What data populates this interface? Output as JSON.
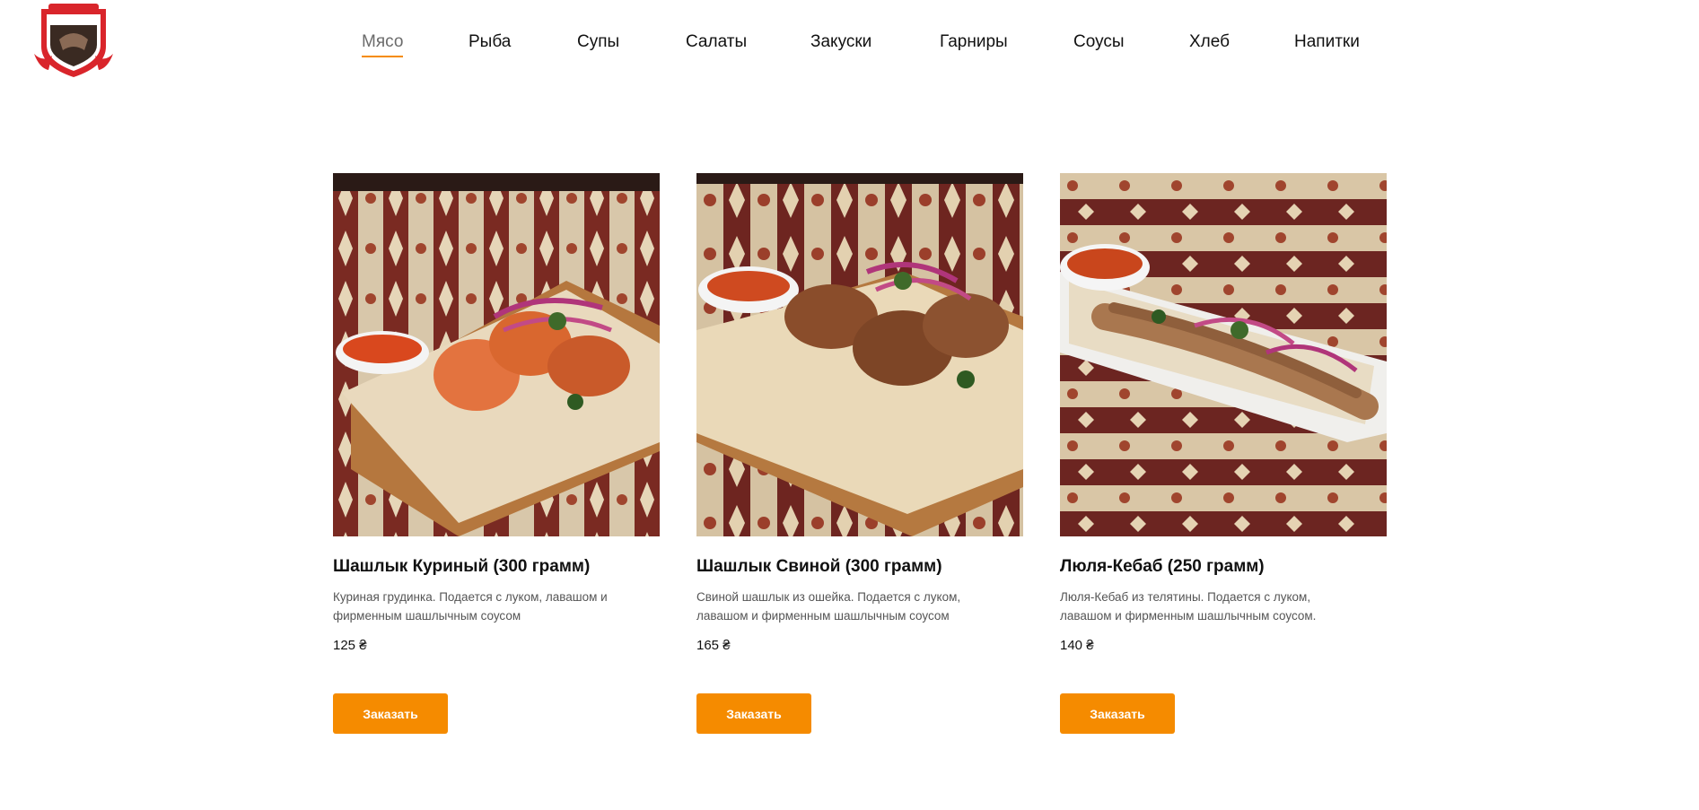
{
  "nav": {
    "items": [
      {
        "label": "Мясо",
        "active": true
      },
      {
        "label": "Рыба"
      },
      {
        "label": "Супы"
      },
      {
        "label": "Салаты"
      },
      {
        "label": "Закуски"
      },
      {
        "label": "Гарниры"
      },
      {
        "label": "Соусы"
      },
      {
        "label": "Хлеб"
      },
      {
        "label": "Напитки"
      }
    ]
  },
  "menu": {
    "items": [
      {
        "title": "Шашлык Куриный (300 грамм)",
        "description": "Куриная грудинка. Подается с луком, лавашом и фирменным шашлычным соусом",
        "price": "125 ₴",
        "button": "Заказать"
      },
      {
        "title": "Шашлык Свиной (300 грамм)",
        "description": "Свиной шашлык из ошейка. Подается с луком, лавашом и фирменным шашлычным соусом",
        "price": "165 ₴",
        "button": "Заказать"
      },
      {
        "title": "Люля-Кебаб (250 грамм)",
        "description": "Люля-Кебаб из телятины. Подается с луком, лавашом и фирменным шашлычным соусом.",
        "price": "140 ₴",
        "button": "Заказать"
      }
    ]
  },
  "colors": {
    "accent": "#f58b00",
    "logo_red": "#d9252b"
  }
}
